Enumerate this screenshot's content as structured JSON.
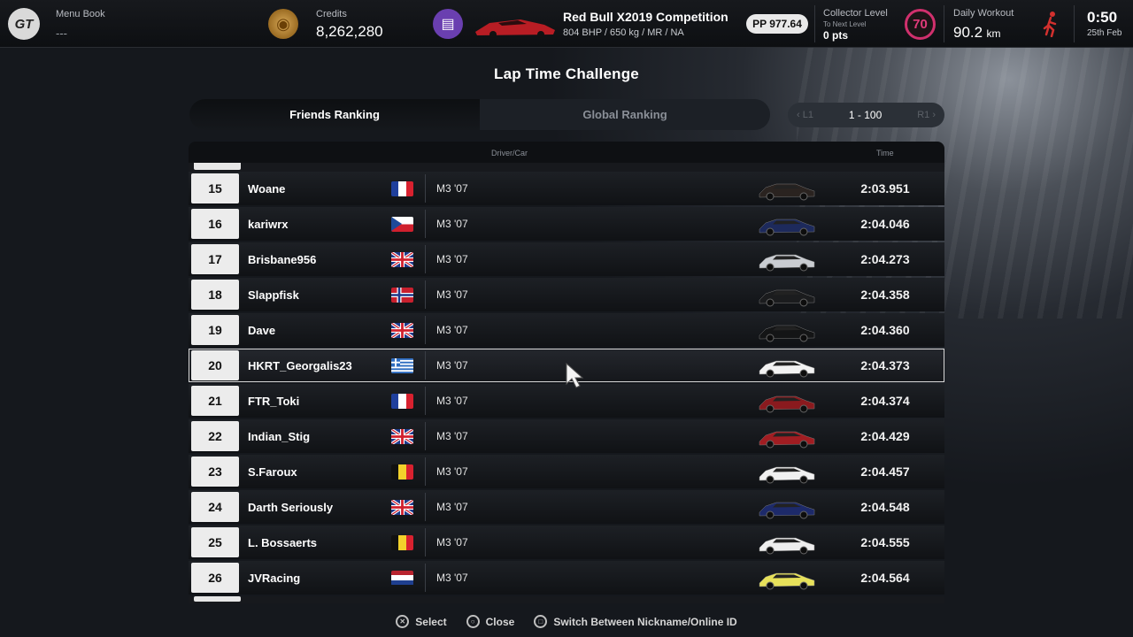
{
  "topbar": {
    "menu_book_label": "Menu Book",
    "menu_book_value": "---",
    "credits_label": "Credits",
    "credits_value": "8,262,280",
    "car_name": "Red Bull X2019 Competition",
    "car_specs": "804 BHP / 650 kg / MR / NA",
    "pp": "PP 977.64",
    "collector_label": "Collector Level",
    "collector_sub": "To Next Level",
    "collector_pts": "0 pts",
    "collector_level": "70",
    "daily_label": "Daily Workout",
    "daily_value": "90.2",
    "daily_unit": "km",
    "clock": "0:50",
    "date": "25th Feb",
    "logo_text": "GT"
  },
  "page": {
    "title": "Lap Time Challenge"
  },
  "tabs": [
    {
      "label": "Friends Ranking",
      "active": true
    },
    {
      "label": "Global Ranking",
      "active": false
    }
  ],
  "pager": {
    "prev": "L1",
    "range": "1 - 100",
    "next": "R1"
  },
  "table": {
    "header_driver": "Driver/Car",
    "header_time": "Time",
    "rows": [
      {
        "pos": "15",
        "name": "Woane",
        "flag": "fr",
        "car": "M3 '07",
        "car_color": "#2a2320",
        "time": "2:03.951"
      },
      {
        "pos": "16",
        "name": "kariwrx",
        "flag": "cz",
        "car": "M3 '07",
        "car_color": "#1d2a5c",
        "time": "2:04.046"
      },
      {
        "pos": "17",
        "name": "Brisbane956",
        "flag": "gb",
        "car": "M3 '07",
        "car_color": "#c9ccd1",
        "time": "2:04.273"
      },
      {
        "pos": "18",
        "name": "Slappfisk",
        "flag": "no",
        "car": "M3 '07",
        "car_color": "#1b1c1e",
        "time": "2:04.358"
      },
      {
        "pos": "19",
        "name": "Dave",
        "flag": "gb",
        "car": "M3 '07",
        "car_color": "#141516",
        "time": "2:04.360"
      },
      {
        "pos": "20",
        "name": "HKRT_Georgalis23",
        "flag": "gr",
        "car": "M3 '07",
        "car_color": "#f2f2f2",
        "time": "2:04.373",
        "selected": true
      },
      {
        "pos": "21",
        "name": "FTR_Toki",
        "flag": "fr",
        "car": "M3 '07",
        "car_color": "#8a1a1e",
        "time": "2:04.374"
      },
      {
        "pos": "22",
        "name": "Indian_Stig",
        "flag": "gb",
        "car": "M3 '07",
        "car_color": "#a11d22",
        "time": "2:04.429"
      },
      {
        "pos": "23",
        "name": "S.Faroux",
        "flag": "be",
        "car": "M3 '07",
        "car_color": "#f0f0f0",
        "time": "2:04.457"
      },
      {
        "pos": "24",
        "name": "Darth Seriously",
        "flag": "gb",
        "car": "M3 '07",
        "car_color": "#1d2a6a",
        "time": "2:04.548"
      },
      {
        "pos": "25",
        "name": "L. Bossaerts",
        "flag": "be",
        "car": "M3 '07",
        "car_color": "#eeeeee",
        "time": "2:04.555"
      },
      {
        "pos": "26",
        "name": "JVRacing",
        "flag": "nl",
        "car": "M3 '07",
        "car_color": "#e7e15a",
        "time": "2:04.564"
      }
    ]
  },
  "footer": {
    "select": "Select",
    "close": "Close",
    "switch": "Switch Between Nickname/Online ID"
  },
  "colors": {
    "accent_level": "#d0306d",
    "position_box": "#ececec"
  }
}
